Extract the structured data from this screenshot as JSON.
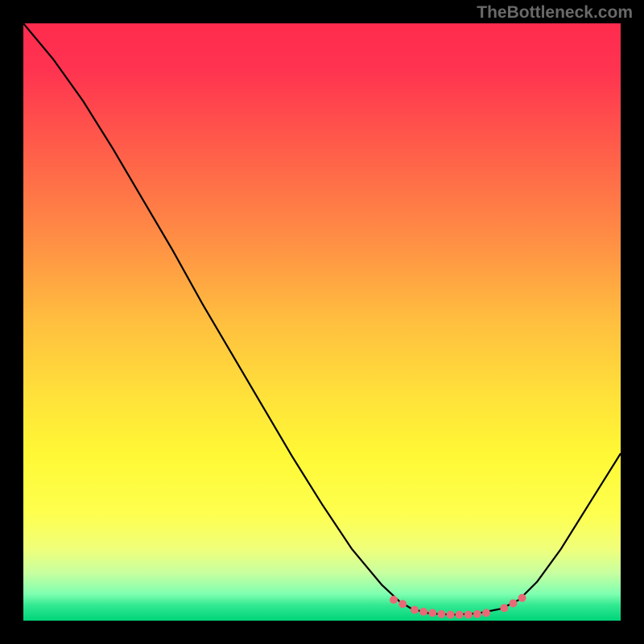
{
  "attribution": "TheBottleneck.com",
  "gradient": {
    "stops": [
      {
        "offset": "0%",
        "color": "#ff2b4e"
      },
      {
        "offset": "8%",
        "color": "#ff3450"
      },
      {
        "offset": "20%",
        "color": "#ff5a4a"
      },
      {
        "offset": "35%",
        "color": "#ff8a45"
      },
      {
        "offset": "50%",
        "color": "#ffbf3f"
      },
      {
        "offset": "62%",
        "color": "#ffe03a"
      },
      {
        "offset": "72%",
        "color": "#fff835"
      },
      {
        "offset": "82%",
        "color": "#feff4e"
      },
      {
        "offset": "88%",
        "color": "#f0ff7a"
      },
      {
        "offset": "92%",
        "color": "#c8ffa0"
      },
      {
        "offset": "95.5%",
        "color": "#80ffb0"
      },
      {
        "offset": "97.5%",
        "color": "#30e890"
      },
      {
        "offset": "100%",
        "color": "#00d47a"
      }
    ]
  },
  "marker_color": "#e96a77",
  "marker_radius": 5,
  "chart_data": {
    "type": "line",
    "title": "",
    "xlabel": "",
    "ylabel": "",
    "xlim": [
      0,
      100
    ],
    "ylim": [
      0,
      100
    ],
    "curve": [
      {
        "x": 0.0,
        "y": 100.0
      },
      {
        "x": 5.0,
        "y": 94.0
      },
      {
        "x": 10.0,
        "y": 87.0
      },
      {
        "x": 15.0,
        "y": 79.0
      },
      {
        "x": 20.0,
        "y": 70.5
      },
      {
        "x": 25.0,
        "y": 62.0
      },
      {
        "x": 30.0,
        "y": 53.0
      },
      {
        "x": 35.0,
        "y": 44.5
      },
      {
        "x": 40.0,
        "y": 36.0
      },
      {
        "x": 45.0,
        "y": 27.5
      },
      {
        "x": 50.0,
        "y": 19.5
      },
      {
        "x": 55.0,
        "y": 12.0
      },
      {
        "x": 60.0,
        "y": 6.0
      },
      {
        "x": 63.0,
        "y": 3.2
      },
      {
        "x": 65.0,
        "y": 2.0
      },
      {
        "x": 68.0,
        "y": 1.2
      },
      {
        "x": 72.0,
        "y": 1.0
      },
      {
        "x": 76.0,
        "y": 1.2
      },
      {
        "x": 80.0,
        "y": 2.0
      },
      {
        "x": 83.0,
        "y": 3.5
      },
      {
        "x": 86.0,
        "y": 6.5
      },
      {
        "x": 90.0,
        "y": 12.0
      },
      {
        "x": 95.0,
        "y": 20.0
      },
      {
        "x": 100.0,
        "y": 28.0
      }
    ],
    "markers": [
      {
        "x": 62.0,
        "y": 3.5
      },
      {
        "x": 63.5,
        "y": 2.8
      },
      {
        "x": 65.5,
        "y": 1.8
      },
      {
        "x": 67.0,
        "y": 1.5
      },
      {
        "x": 68.5,
        "y": 1.3
      },
      {
        "x": 70.0,
        "y": 1.1
      },
      {
        "x": 71.5,
        "y": 1.0
      },
      {
        "x": 73.0,
        "y": 1.0
      },
      {
        "x": 74.5,
        "y": 1.0
      },
      {
        "x": 76.0,
        "y": 1.1
      },
      {
        "x": 77.5,
        "y": 1.3
      },
      {
        "x": 80.5,
        "y": 2.1
      },
      {
        "x": 82.0,
        "y": 2.9
      },
      {
        "x": 83.5,
        "y": 3.8
      }
    ]
  }
}
